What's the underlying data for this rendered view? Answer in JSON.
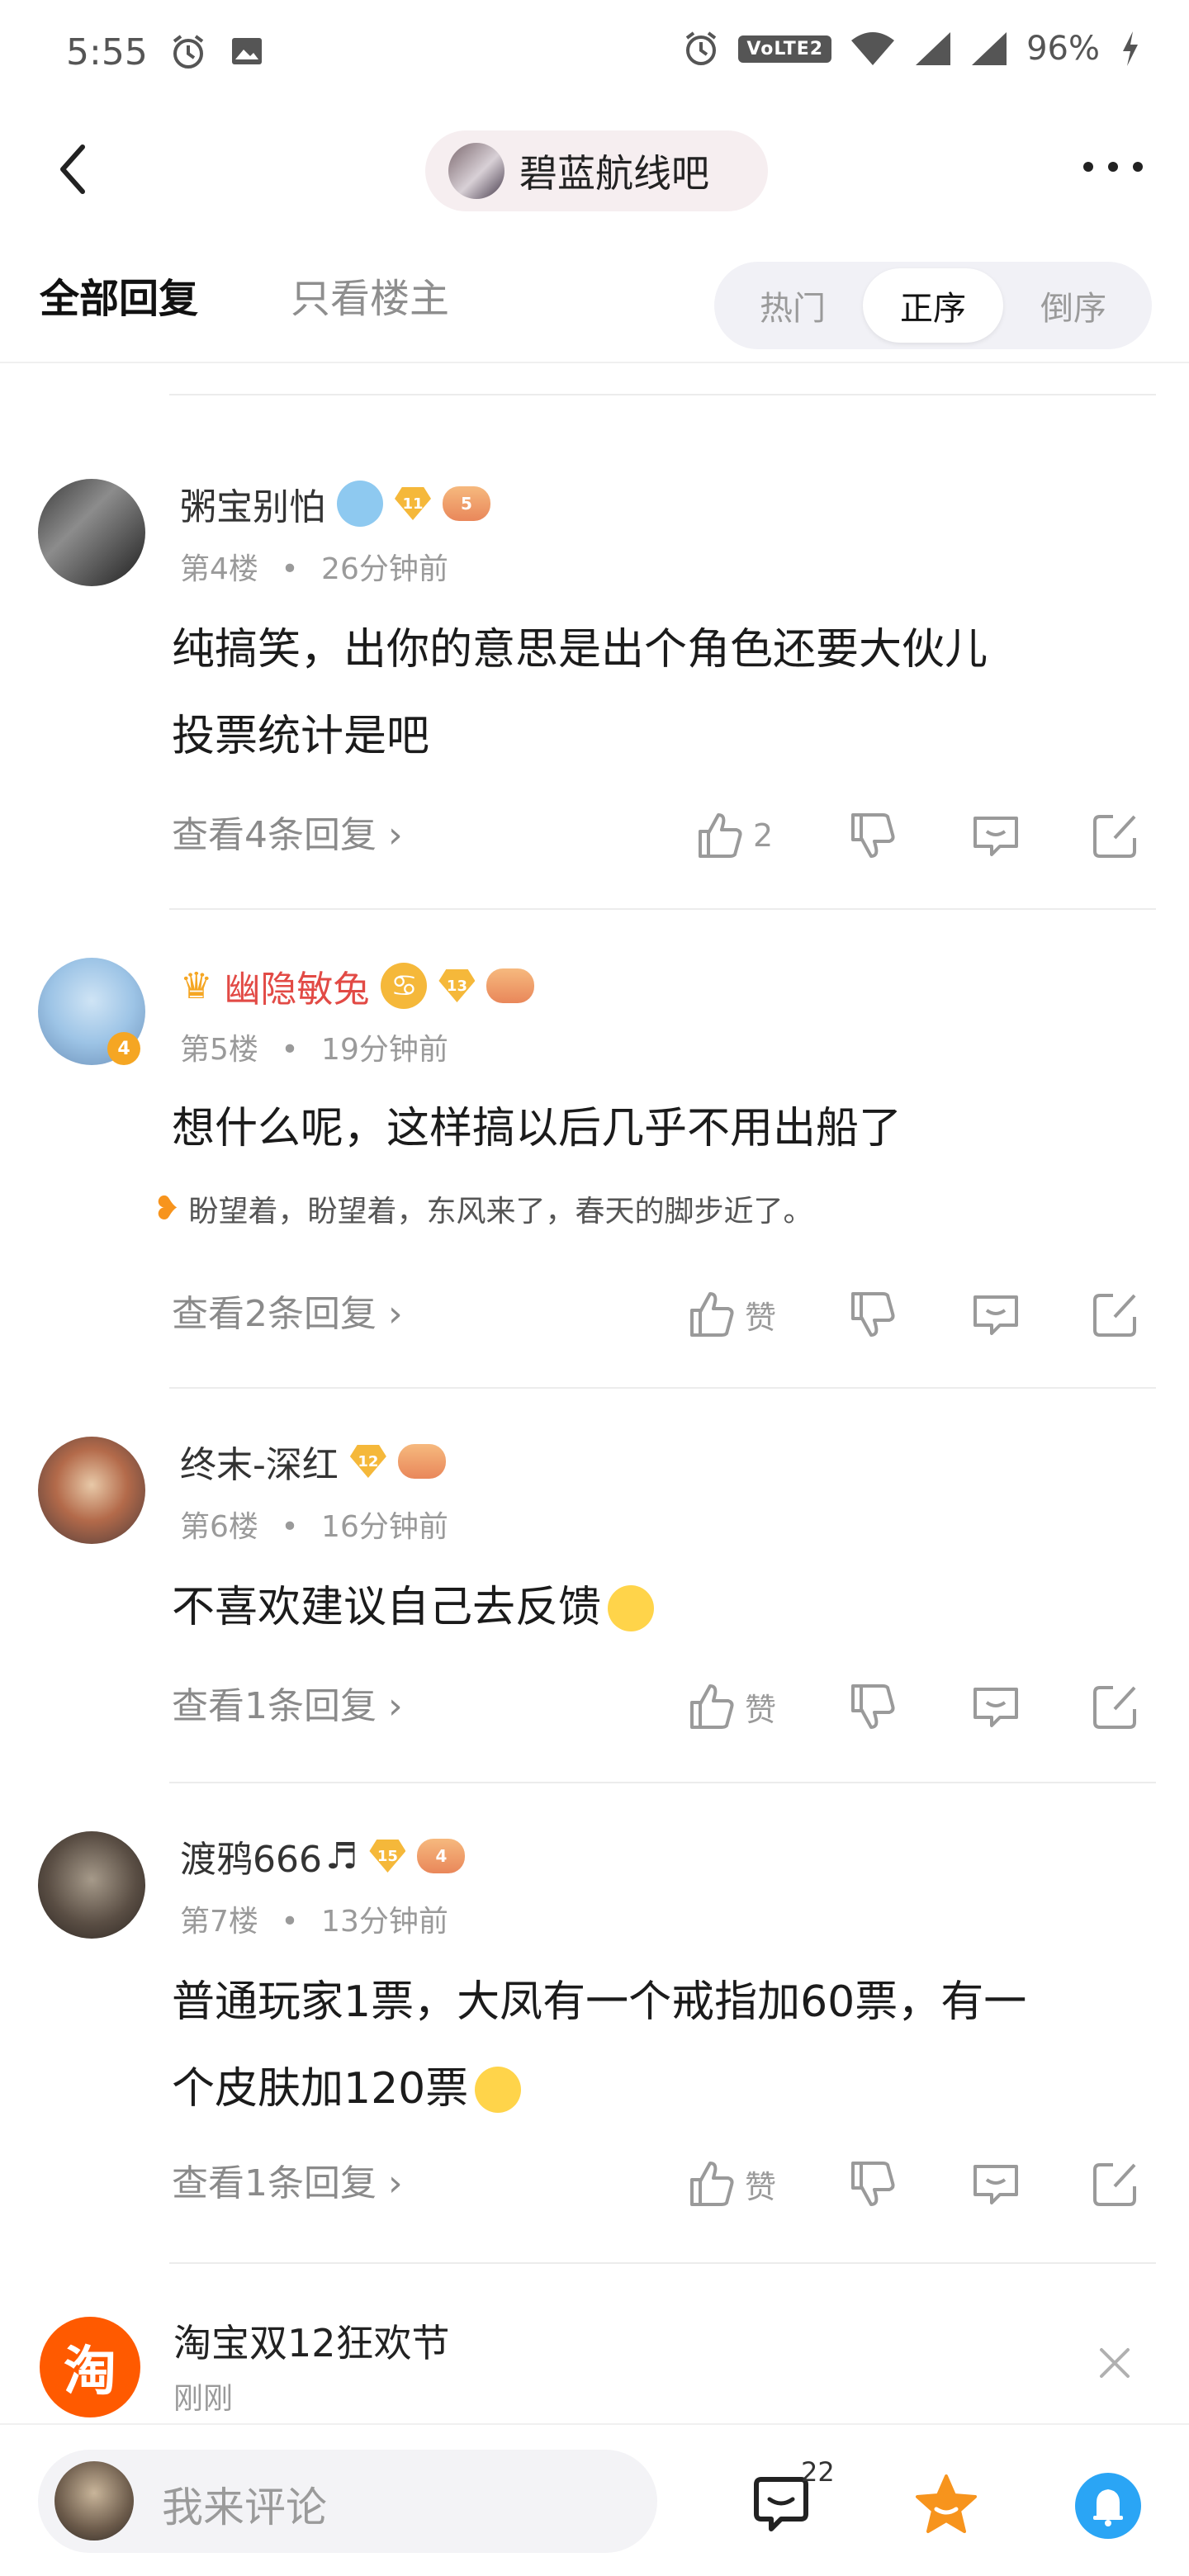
{
  "status_bar": {
    "time": "5:55",
    "volte": "VoLTE2",
    "battery": "96%"
  },
  "header": {
    "forum_name": "碧蓝航线吧"
  },
  "tabs": {
    "all_replies": "全部回复",
    "only_op": "只看楼主"
  },
  "sort": {
    "hot": "热门",
    "asc": "正序",
    "desc": "倒序",
    "selected": "正序"
  },
  "posts": [
    {
      "author": "粥宝别怕",
      "level": "11",
      "game_badge": "5",
      "floor": "第4楼",
      "time": "26分钟前",
      "content": [
        "纯搞笑，出你的意思是出个角色还要大伙儿",
        "投票统计是吧"
      ],
      "replies_label": "查看4条回复 ›",
      "like_label": "2"
    },
    {
      "author": "幽隐敏兔",
      "level": "13",
      "game_badge": "",
      "floor": "第5楼",
      "time": "19分钟前",
      "content": [
        "想什么呢，这样搞以后几乎不用出船了"
      ],
      "signature": "盼望着，盼望着，东风来了，春天的脚步近了。",
      "replies_label": "查看2条回复 ›",
      "like_label": "赞",
      "avatar_level": "4"
    },
    {
      "author": "终末-深红",
      "level": "12",
      "game_badge": "",
      "floor": "第6楼",
      "time": "16分钟前",
      "content": [
        "不喜欢建议自己去反馈"
      ],
      "replies_label": "查看1条回复 ›",
      "like_label": "赞"
    },
    {
      "author": "渡鸦666",
      "level": "15",
      "game_badge": "4",
      "floor": "第7楼",
      "time": "13分钟前",
      "content": [
        "普通玩家1票，大凤有一个戒指加60票，有一",
        "个皮肤加120票"
      ],
      "replies_label": "查看1条回复 ›",
      "like_label": "赞"
    }
  ],
  "notification": {
    "logo_text": "淘",
    "title": "淘宝双12狂欢节",
    "time": "刚刚"
  },
  "bottom_bar": {
    "comment_placeholder": "我来评论",
    "comment_count": "22"
  },
  "icons": [
    "alarm-icon",
    "image-icon",
    "wifi-icon",
    "signal-icon",
    "battery-icon",
    "back-icon",
    "more-icon",
    "like-icon",
    "dislike-icon",
    "comment-icon",
    "share-icon",
    "close-icon",
    "chat-icon",
    "favorite-star-icon",
    "bell-icon"
  ],
  "colors": {
    "red_username": "#e24a45",
    "taobao_orange": "#ff5a00",
    "star_orange": "#f7941d",
    "bell_blue": "#2aa5f5"
  }
}
